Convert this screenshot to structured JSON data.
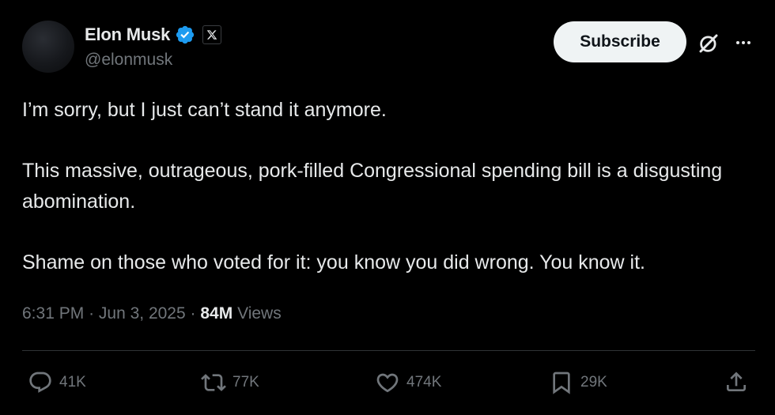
{
  "author": {
    "display_name": "Elon Musk",
    "handle": "@elonmusk",
    "verified": true,
    "affiliation_badge": "X"
  },
  "header": {
    "subscribe_label": "Subscribe"
  },
  "tweet": {
    "paragraphs": [
      "I’m sorry, but I just can’t stand it anymore.",
      "This massive, outrageous, pork-filled Congressional spending bill is a disgusting abomination.",
      "Shame on those who voted for it: you know you did wrong. You know it."
    ]
  },
  "meta": {
    "time": "6:31 PM",
    "separator": "·",
    "date": "Jun 3, 2025",
    "views_count": "84M",
    "views_label": "Views"
  },
  "actions": {
    "replies": "41K",
    "reposts": "77K",
    "likes": "474K",
    "bookmarks": "29K"
  },
  "icons": {
    "verified": "verified-badge-icon",
    "grok": "grok-icon",
    "more": "more-icon",
    "reply": "reply-icon",
    "repost": "repost-icon",
    "like": "like-icon",
    "bookmark": "bookmark-icon",
    "share": "share-icon"
  },
  "colors": {
    "background": "#000000",
    "text_primary": "#e7e9ea",
    "text_secondary": "#71767b",
    "verified_blue": "#1d9bf0",
    "subscribe_bg": "#eff3f4",
    "divider": "#2f3336"
  }
}
